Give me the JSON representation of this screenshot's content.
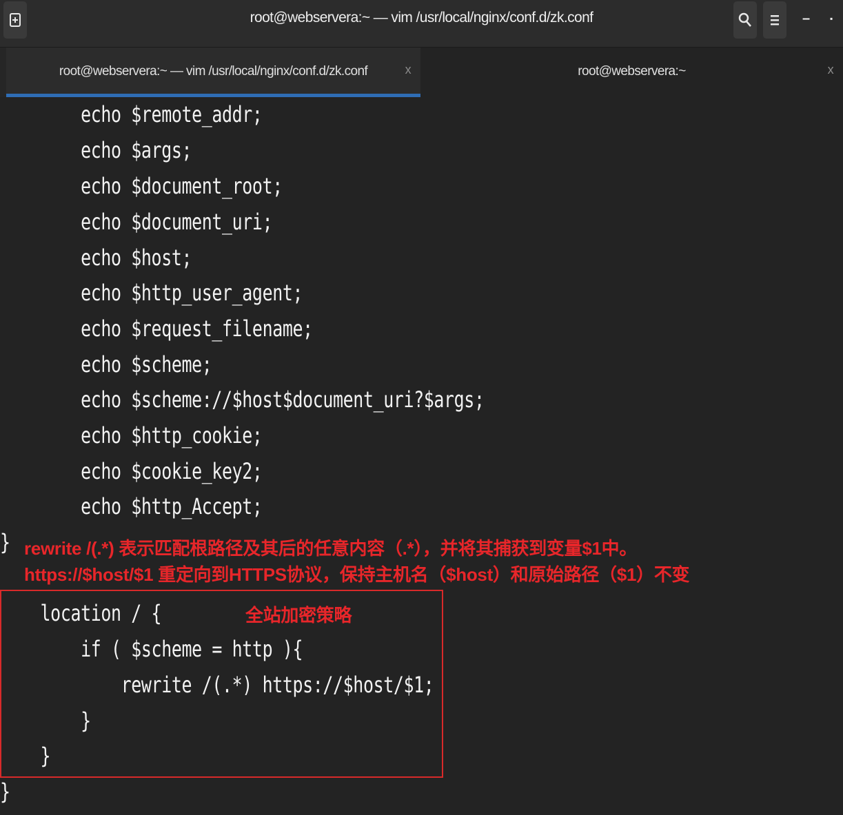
{
  "window": {
    "title": "root@webservera:~ — vim /usr/local/nginx/conf.d/zk.conf",
    "new_tab_icon": "new-tab-icon",
    "search_icon": "search-icon",
    "menu_icon": "hamburger-menu-icon",
    "minimize_label": "–",
    "maximize_label": "▪"
  },
  "tabs": [
    {
      "label": "root@webservera:~ — vim /usr/local/nginx/conf.d/zk.conf",
      "close": "x",
      "active": true
    },
    {
      "label": "root@webservera:~",
      "close": "x",
      "active": false
    }
  ],
  "code_lines": [
    "        echo $remote_addr;",
    "        echo $args;",
    "        echo $document_root;",
    "        echo $document_uri;",
    "        echo $host;",
    "        echo $http_user_agent;",
    "        echo $request_filename;",
    "        echo $scheme;",
    "        echo $scheme://$host$document_uri?$args;",
    "        echo $http_cookie;",
    "        echo $cookie_key2;",
    "        echo $http_Accept;",
    "}",
    "    location / {",
    "        if ( $scheme = http ){",
    "            rewrite /(.*) https://$host/$1;",
    "        }",
    "    }",
    "}"
  ],
  "annotations": {
    "line1": "rewrite /(.*) 表示匹配根路径及其后的任意内容（.*），并将其捕获到变量$1中。",
    "line2": "https://$host/$1 重定向到HTTPS协议，保持主机名（$host）和原始路径（$1）不变",
    "box_label": "全站加密策略"
  },
  "colors": {
    "background": "#232323",
    "text": "#f2f2f2",
    "annotation": "#e8262a",
    "tab_underline": "#2f6db5"
  }
}
